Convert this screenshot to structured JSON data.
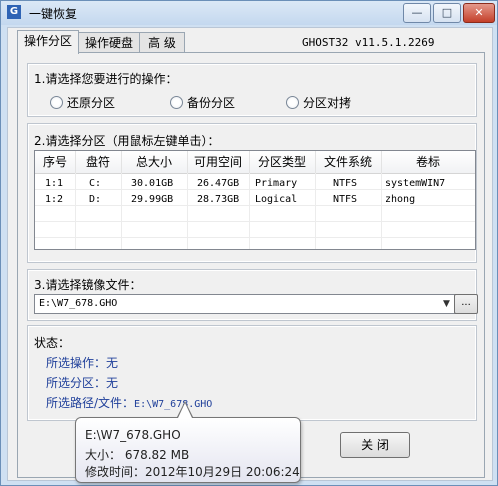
{
  "window": {
    "title": "一键恢复",
    "min_glyph": "—",
    "max_glyph": "□",
    "close_glyph": "✕"
  },
  "tabs": [
    {
      "label": "操作分区",
      "active": true
    },
    {
      "label": "操作硬盘",
      "active": false
    },
    {
      "label": "高 级",
      "active": false
    }
  ],
  "ghost_version": "GHOST32 v11.5.1.2269",
  "operation": {
    "label": "1.请选择您要进行的操作：",
    "options": [
      "还原分区",
      "备份分区",
      "分区对拷"
    ]
  },
  "partition": {
    "label": "2.请选择分区（用鼠标左键单击）：",
    "columns": [
      "序号",
      "盘符",
      "总大小",
      "可用空间",
      "分区类型",
      "文件系统",
      "卷标"
    ],
    "rows": [
      [
        "1:1",
        "C:",
        "30.01GB",
        "26.47GB",
        "Primary",
        "NTFS",
        "systemWIN7"
      ],
      [
        "1:2",
        "D:",
        "29.99GB",
        "28.73GB",
        "Logical",
        "NTFS",
        "zhong"
      ]
    ]
  },
  "image": {
    "label": "3.请选择镜像文件：",
    "value": "E:\\W7_678.GHO",
    "browse_label": "..."
  },
  "status": {
    "label": "状态：",
    "selected_op": "所选操作：无",
    "selected_partition": "所选分区：无",
    "selected_path_label": "所选路径/文件：",
    "selected_path_value": "E:\\W7_678.GHO"
  },
  "close_button": "关 闭",
  "tooltip": {
    "path": "E:\\W7_678.GHO",
    "size": "大小：  678.82 MB",
    "modified": "修改时间：2012年10月29日 20:06:24"
  },
  "colors": {
    "status_text": "#1f3f9a",
    "close_control": "#c4402a"
  },
  "icons": {
    "app": "app-icon",
    "dropdown": "chevron-down-icon"
  }
}
